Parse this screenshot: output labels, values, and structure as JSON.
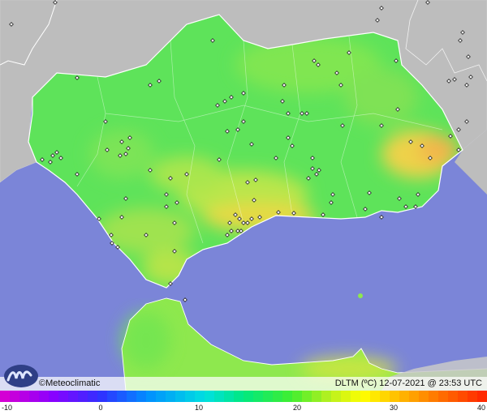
{
  "map": {
    "brand": "©Meteoclimatic",
    "product_label": "DLTM (ºC)",
    "datetime": "12-07-2021 @ 23:53 UTC"
  },
  "legend": {
    "ticks": [
      "-10",
      "0",
      "10",
      "20",
      "30",
      "40"
    ]
  },
  "colors": {
    "sea": "#7b85d8",
    "land_outside": "#bfbfbf",
    "land_green": "#5ee35a",
    "land_lightgreen": "#8ee84e",
    "land_yellow": "#d8e640",
    "land_orange": "#f0c43a",
    "border": "#ffffff",
    "station": "#222222"
  },
  "icons": {
    "logo": "meteoclimatic-wave-logo",
    "station_marker": "diamond-marker"
  }
}
